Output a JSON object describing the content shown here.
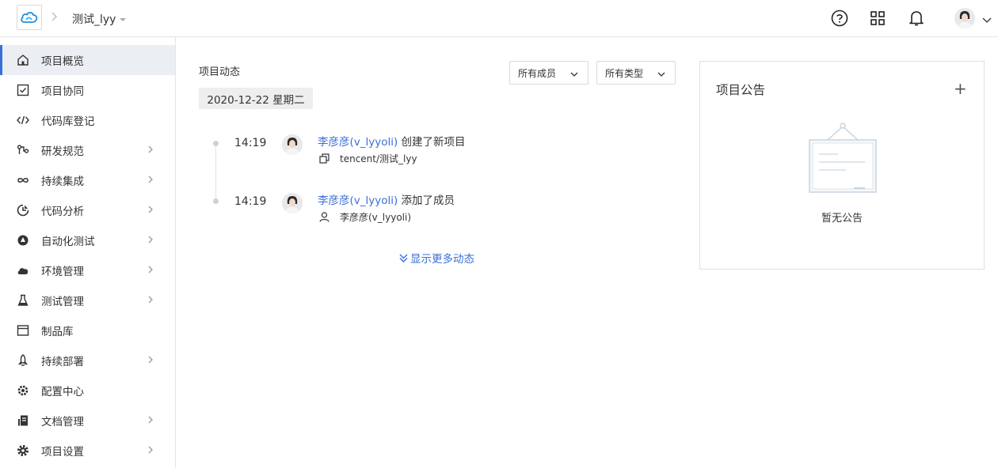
{
  "header": {
    "project_name": "测试_lyy",
    "icons": [
      "help-icon",
      "apps-grid-icon",
      "bell-icon"
    ]
  },
  "sidebar": {
    "items": [
      {
        "label": "项目概览",
        "icon": "home-icon",
        "active": true,
        "has_children": false
      },
      {
        "label": "项目协同",
        "icon": "checkbox-icon",
        "active": false,
        "has_children": false
      },
      {
        "label": "代码库登记",
        "icon": "code-icon",
        "active": false,
        "has_children": false
      },
      {
        "label": "研发规范",
        "icon": "branch-icon",
        "active": false,
        "has_children": true
      },
      {
        "label": "持续集成",
        "icon": "infinity-icon",
        "active": false,
        "has_children": true
      },
      {
        "label": "代码分析",
        "icon": "analysis-icon",
        "active": false,
        "has_children": true
      },
      {
        "label": "自动化测试",
        "icon": "automation-icon",
        "active": false,
        "has_children": true
      },
      {
        "label": "环境管理",
        "icon": "cloud-icon",
        "active": false,
        "has_children": true
      },
      {
        "label": "测试管理",
        "icon": "flask-icon",
        "active": false,
        "has_children": true
      },
      {
        "label": "制品库",
        "icon": "archive-icon",
        "active": false,
        "has_children": false
      },
      {
        "label": "持续部署",
        "icon": "rocket-icon",
        "active": false,
        "has_children": true
      },
      {
        "label": "配置中心",
        "icon": "config-icon",
        "active": false,
        "has_children": false
      },
      {
        "label": "文档管理",
        "icon": "document-icon",
        "active": false,
        "has_children": true
      },
      {
        "label": "项目设置",
        "icon": "settings-icon",
        "active": false,
        "has_children": true
      }
    ]
  },
  "feed": {
    "title": "项目动态",
    "filters": {
      "members": "所有成员",
      "types": "所有类型"
    },
    "date": "2020-12-22 星期二",
    "entries": [
      {
        "time": "14:19",
        "user": "李彦彦(v_lyyoli)",
        "action": " 创建了新项目",
        "detail": "tencent/测试_lyy",
        "detail_icon": "copy-icon"
      },
      {
        "time": "14:19",
        "user": "李彦彦(v_lyyoli)",
        "action": " 添加了成员",
        "detail": "李彦彦(v_lyyoli)",
        "detail_icon": "user-icon"
      }
    ],
    "more": "显示更多动态"
  },
  "notice": {
    "title": "项目公告",
    "add": "+",
    "empty": "暂无公告"
  },
  "colors": {
    "accent": "#3a6fd8",
    "active_bg": "#ebeef3",
    "border": "#e5e5e5"
  }
}
